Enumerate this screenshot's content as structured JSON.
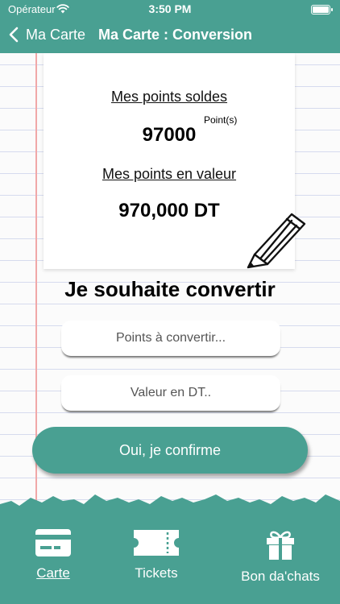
{
  "status_bar": {
    "carrier": "Opérateur",
    "time": "3:50 PM"
  },
  "nav": {
    "back_label": "Ma Carte",
    "title": "Ma Carte : Conversion"
  },
  "balance": {
    "points_label": "Mes points soldes",
    "points_value": "97000",
    "points_unit": "Point(s)",
    "value_label": "Mes points en valeur",
    "value_amount": "970,000 DT"
  },
  "convert": {
    "title": "Je souhaite convertir",
    "points_placeholder": "Points à convertir...",
    "value_placeholder": "Valeur en DT.."
  },
  "confirm_button": "Oui, je confirme",
  "tabs": [
    {
      "label": "Carte",
      "icon": "card-icon",
      "active": true
    },
    {
      "label": "Tickets",
      "icon": "ticket-icon",
      "active": false
    },
    {
      "label": "Bon da'chats",
      "icon": "gift-icon",
      "active": false
    }
  ],
  "colors": {
    "accent": "#49a092",
    "paper_lines": "#d6dbee",
    "margin_line": "#f1a8a8"
  }
}
